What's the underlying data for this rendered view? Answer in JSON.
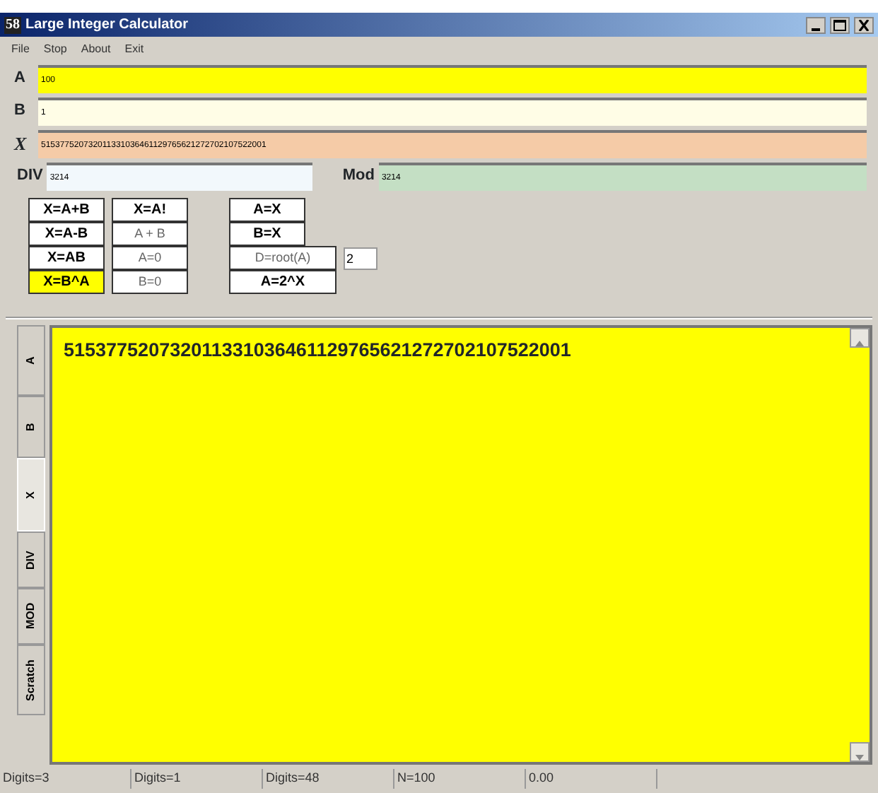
{
  "window": {
    "title": "Large Integer Calculator",
    "icon": "58"
  },
  "menu": [
    "File",
    "Stop",
    "About",
    "Exit"
  ],
  "fields": [
    {
      "label": "A",
      "value": "100",
      "color": "#ffff00"
    },
    {
      "label": "B",
      "value": "1",
      "color": "#fffde6"
    },
    {
      "label": "X",
      "value": "515377520732011331036461129765621272702107522001",
      "color": "#f5cba7"
    }
  ],
  "div": {
    "label": "DIV",
    "value": "3214"
  },
  "mod": {
    "label": "Mod",
    "value": "3214"
  },
  "button_columns": [
    [
      {
        "label": "X=A+B",
        "kind": "bold",
        "selected": false
      },
      {
        "label": "X=A-B",
        "kind": "bold",
        "selected": false
      },
      {
        "label": "X=AB",
        "kind": "bold",
        "selected": false
      },
      {
        "label": "X=B^A",
        "kind": "bold",
        "selected": true
      }
    ],
    [
      {
        "label": "X=A!",
        "kind": "bold",
        "selected": false
      },
      {
        "label": "A + B",
        "kind": "plain",
        "selected": false
      },
      {
        "label": "A=0",
        "kind": "plain",
        "selected": false
      },
      {
        "label": "B=0",
        "kind": "plain",
        "selected": false
      }
    ],
    [
      {
        "label": "A=X",
        "kind": "bold",
        "selected": false
      },
      {
        "label": "B=X",
        "kind": "bold",
        "selected": false
      },
      {
        "label": "D=root(A)",
        "kind": "plain",
        "selected": false
      },
      {
        "label": "A=2^X",
        "kind": "bold",
        "selected": false
      }
    ]
  ],
  "root_degree": "2",
  "tabs": [
    {
      "label": "A",
      "selected": false
    },
    {
      "label": "B",
      "selected": false
    },
    {
      "label": "X",
      "selected": true
    },
    {
      "label": "DIV",
      "selected": false
    },
    {
      "label": "MOD",
      "selected": false
    },
    {
      "label": "Scratch",
      "selected": false
    }
  ],
  "output": "515377520732011331036461129765621272702107522001",
  "status_bar": [
    "Digits=3",
    "Digits=1",
    "Digits=48",
    "N=100",
    "0.00"
  ]
}
